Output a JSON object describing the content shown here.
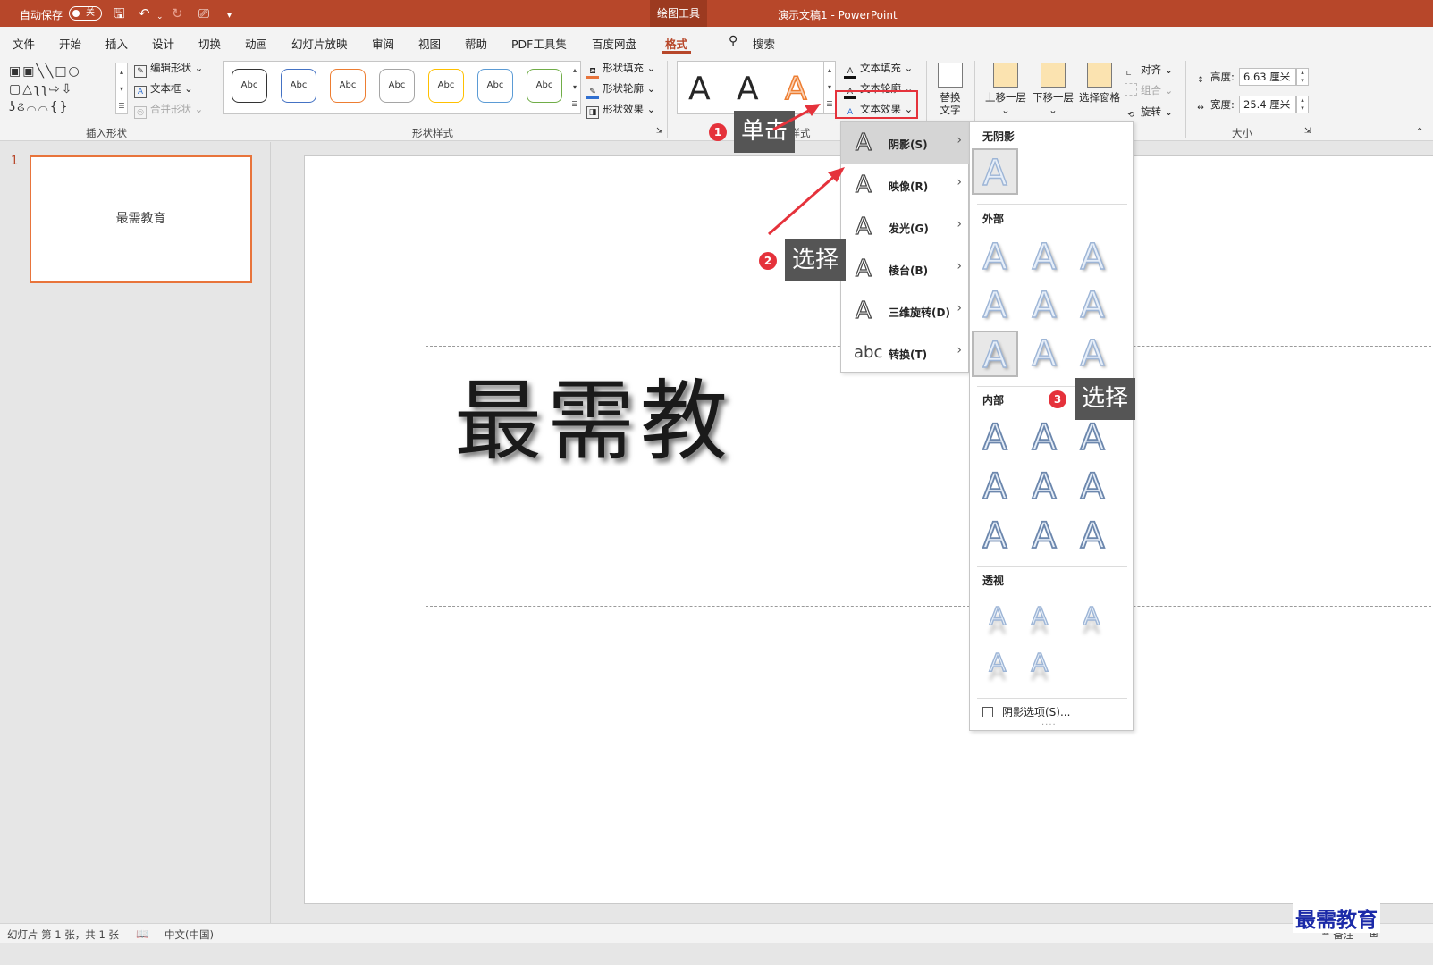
{
  "titlebar": {
    "autosave_label": "自动保存",
    "autosave_state": "关",
    "contextual_tab": "绘图工具",
    "doc_title": "演示文稿1  -  PowerPoint"
  },
  "tabs": [
    {
      "label": "文件"
    },
    {
      "label": "开始"
    },
    {
      "label": "插入"
    },
    {
      "label": "设计"
    },
    {
      "label": "切换"
    },
    {
      "label": "动画"
    },
    {
      "label": "幻灯片放映"
    },
    {
      "label": "审阅"
    },
    {
      "label": "视图"
    },
    {
      "label": "帮助"
    },
    {
      "label": "PDF工具集"
    },
    {
      "label": "百度网盘"
    },
    {
      "label": "格式"
    }
  ],
  "search_label": "搜索",
  "ribbon": {
    "insert_shapes": {
      "group_label": "插入形状",
      "edit_shape": "编辑形状",
      "text_box": "文本框",
      "merge_shapes": "合并形状"
    },
    "shape_styles": {
      "group_label": "形状样式",
      "style_sample": "Abc",
      "style_colors": [
        "#333333",
        "#4472c4",
        "#ed7d31",
        "#a5a5a5",
        "#ffc000",
        "#5b9bd5",
        "#70ad47"
      ],
      "shape_fill": "形状填充",
      "shape_outline": "形状轮廓",
      "shape_effects": "形状效果"
    },
    "wordart_styles": {
      "group_label": "艺术字样式",
      "label_visible_fragment": "字样式",
      "samples": [
        {
          "glyph": "A",
          "color": "#111111"
        },
        {
          "glyph": "A",
          "color": "#4472c4"
        },
        {
          "glyph": "A",
          "color": "#ed7d31"
        }
      ],
      "text_fill": "文本填充",
      "text_outline": "文本轮廓",
      "text_effects": "文本效果"
    },
    "accessibility": {
      "alt_text_line1": "替换",
      "alt_text_line2": "文字"
    },
    "arrange": {
      "bring_forward": "上移一层",
      "send_backward": "下移一层",
      "selection_pane": "选择窗格",
      "align": "对齐",
      "group": "组合",
      "rotate": "旋转"
    },
    "size": {
      "group_label": "大小",
      "height_label": "高度:",
      "height_value": "6.63 厘米",
      "width_label": "宽度:",
      "width_value": "25.4 厘米"
    }
  },
  "slide_panel": {
    "slide_number": "1",
    "thumbnail_text": "最需教育"
  },
  "slide": {
    "text": "最需教"
  },
  "text_effects_menu": [
    {
      "label": "阴影(S)",
      "glyph": "A",
      "selected": true
    },
    {
      "label": "映像(R)",
      "glyph": "A",
      "selected": false
    },
    {
      "label": "发光(G)",
      "glyph": "A",
      "selected": false
    },
    {
      "label": "棱台(B)",
      "glyph": "A",
      "selected": false
    },
    {
      "label": "三维旋转(D)",
      "glyph": "A",
      "selected": false
    },
    {
      "label": "转换(T)",
      "glyph": "abc",
      "selected": false
    }
  ],
  "shadow_menu": {
    "no_shadow": "无阴影",
    "outer": "外部",
    "inner": "内部",
    "perspective": "透视",
    "glyph": "A",
    "options_label": "阴影选项(S)..."
  },
  "callouts": [
    {
      "num": "1",
      "text": "单击"
    },
    {
      "num": "2",
      "text": "选择"
    },
    {
      "num": "3",
      "text": "选择"
    }
  ],
  "statusbar": {
    "slide_info": "幻灯片 第 1 张，共 1 张",
    "language": "中文(中国)",
    "notes": "备注"
  },
  "watermark": "最需教育",
  "colors": {
    "brand": "#b7472a",
    "highlight_red": "#e5323b",
    "thumb_border": "#e8743b",
    "callout_bg": "#555555"
  }
}
